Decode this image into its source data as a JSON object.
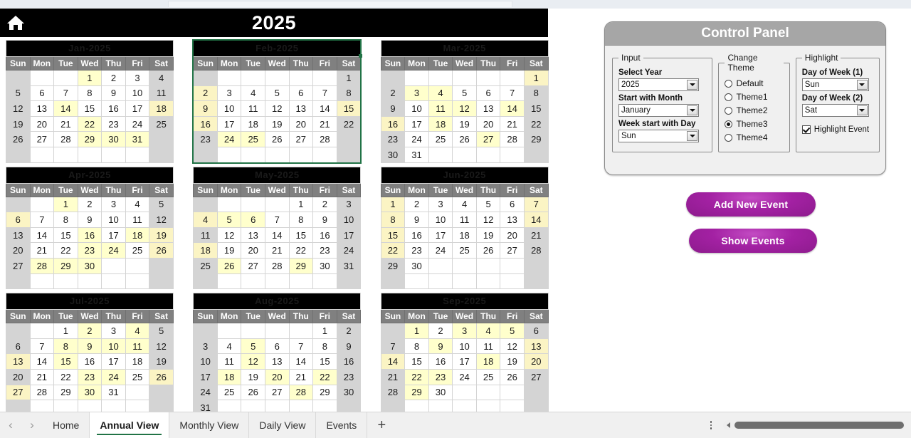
{
  "header": {
    "year": "2025",
    "home_icon": "home-icon"
  },
  "calendar": {
    "dow_headers": [
      "Sun",
      "Mon",
      "Tue",
      "Wed",
      "Thu",
      "Fri",
      "Sat"
    ],
    "weekend_cols": [
      0,
      6
    ],
    "selected_month": "Feb-2025",
    "months": [
      {
        "title": "Jan-2025",
        "first_col": 3,
        "days": 31,
        "highlights": [
          1,
          14,
          18,
          22,
          29,
          30,
          31
        ]
      },
      {
        "title": "Feb-2025",
        "first_col": 6,
        "days": 28,
        "highlights": [
          2,
          9,
          15,
          16,
          24,
          25
        ]
      },
      {
        "title": "Mar-2025",
        "first_col": 6,
        "days": 31,
        "highlights": [
          1,
          3,
          4,
          11,
          12,
          14,
          16,
          18,
          27
        ]
      },
      {
        "title": "Apr-2025",
        "first_col": 2,
        "days": 30,
        "highlights": [
          1,
          6,
          16,
          18,
          19,
          23,
          24,
          26,
          28,
          29,
          30
        ]
      },
      {
        "title": "May-2025",
        "first_col": 4,
        "days": 31,
        "highlights": [
          4,
          5,
          6,
          18,
          26,
          29
        ]
      },
      {
        "title": "Jun-2025",
        "first_col": 0,
        "days": 30,
        "highlights": [
          1,
          7,
          8,
          14,
          15,
          22
        ]
      },
      {
        "title": "Jul-2025",
        "first_col": 2,
        "days": 31,
        "highlights": [
          2,
          4,
          8,
          9,
          10,
          11,
          13,
          15,
          23,
          24,
          26,
          27,
          30
        ]
      },
      {
        "title": "Aug-2025",
        "first_col": 5,
        "days": 31,
        "highlights": [
          5,
          12,
          18,
          20,
          22,
          28
        ]
      },
      {
        "title": "Sep-2025",
        "first_col": 1,
        "days": 30,
        "highlights": [
          1,
          3,
          4,
          5,
          9,
          13,
          14,
          18,
          20,
          22,
          23,
          29
        ]
      }
    ]
  },
  "control_panel": {
    "title": "Control Panel",
    "input_group": {
      "legend": "Input",
      "select_year_label": "Select Year",
      "select_year_value": "2025",
      "start_month_label": "Start with Month",
      "start_month_value": "January",
      "week_start_label": "Week start with Day",
      "week_start_value": "Sun"
    },
    "theme_group": {
      "legend": "Change Theme",
      "options": [
        "Default",
        "Theme1",
        "Theme2",
        "Theme3",
        "Theme4"
      ],
      "selected": "Theme3"
    },
    "highlight_group": {
      "legend": "Highlight",
      "dow1_label": "Day of Week (1)",
      "dow1_value": "Sun",
      "dow2_label": "Day of Week (2)",
      "dow2_value": "Sat",
      "highlight_event_label": "Highlight Event",
      "highlight_event_checked": true
    }
  },
  "actions": {
    "add_event": "Add New Event",
    "show_events": "Show Events"
  },
  "sheet_tabs": {
    "prev_icon": "‹",
    "next_icon": "›",
    "tabs": [
      {
        "label": "Home",
        "active": false
      },
      {
        "label": "Annual View",
        "active": true
      },
      {
        "label": "Monthly View",
        "active": false
      },
      {
        "label": "Daily View",
        "active": false
      },
      {
        "label": "Events",
        "active": false
      }
    ],
    "add_sheet_icon": "+"
  },
  "colors": {
    "header_bg": "#000000",
    "month_title_bg": "#000000",
    "dow_bg": "#808080",
    "weekend_bg": "#d4d4d4",
    "highlight_bg": "#ffffcc",
    "selection_green": "#217346",
    "panel_title_bg": "#a6a6a6",
    "button_magenta": "#a321a3"
  }
}
